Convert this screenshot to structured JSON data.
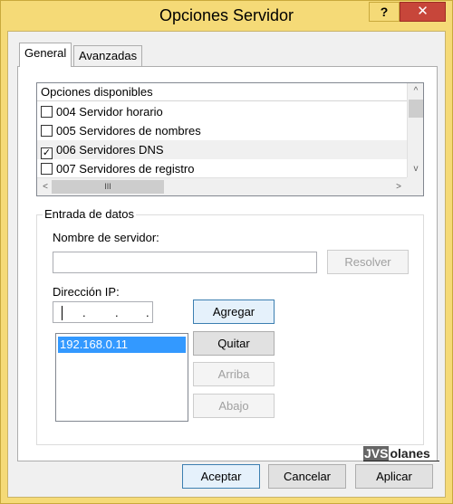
{
  "window": {
    "title": "Opciones Servidor"
  },
  "titlebar_buttons": {
    "help": "?",
    "close": "✕"
  },
  "tabs": [
    {
      "label": "General",
      "selected": true
    },
    {
      "label": "Avanzadas",
      "selected": false
    }
  ],
  "options_list": {
    "header": "Opciones disponibles",
    "items": [
      {
        "label": "004 Servidor horario",
        "checked": false
      },
      {
        "label": "005 Servidores de nombres",
        "checked": false
      },
      {
        "label": "006 Servidores DNS",
        "checked": true
      },
      {
        "label": "007 Servidores de registro",
        "checked": false
      }
    ],
    "scroll": {
      "up": "^",
      "down": "v",
      "left": "<",
      "right": ">",
      "grip": "III"
    }
  },
  "data_entry": {
    "group_title": "Entrada de datos",
    "server_name_label": "Nombre de servidor:",
    "server_name_value": "",
    "resolve_button": "Resolver",
    "ip_label": "Dirección IP:",
    "ip_value": ". . .",
    "add_button": "Agregar",
    "remove_button": "Quitar",
    "up_button": "Arriba",
    "down_button": "Abajo",
    "ip_list": [
      "192.168.0.11"
    ]
  },
  "watermark": {
    "prefix": "JVS",
    "suffix": "olanes"
  },
  "footer": {
    "accept": "Aceptar",
    "cancel": "Cancelar",
    "apply": "Aplicar"
  }
}
